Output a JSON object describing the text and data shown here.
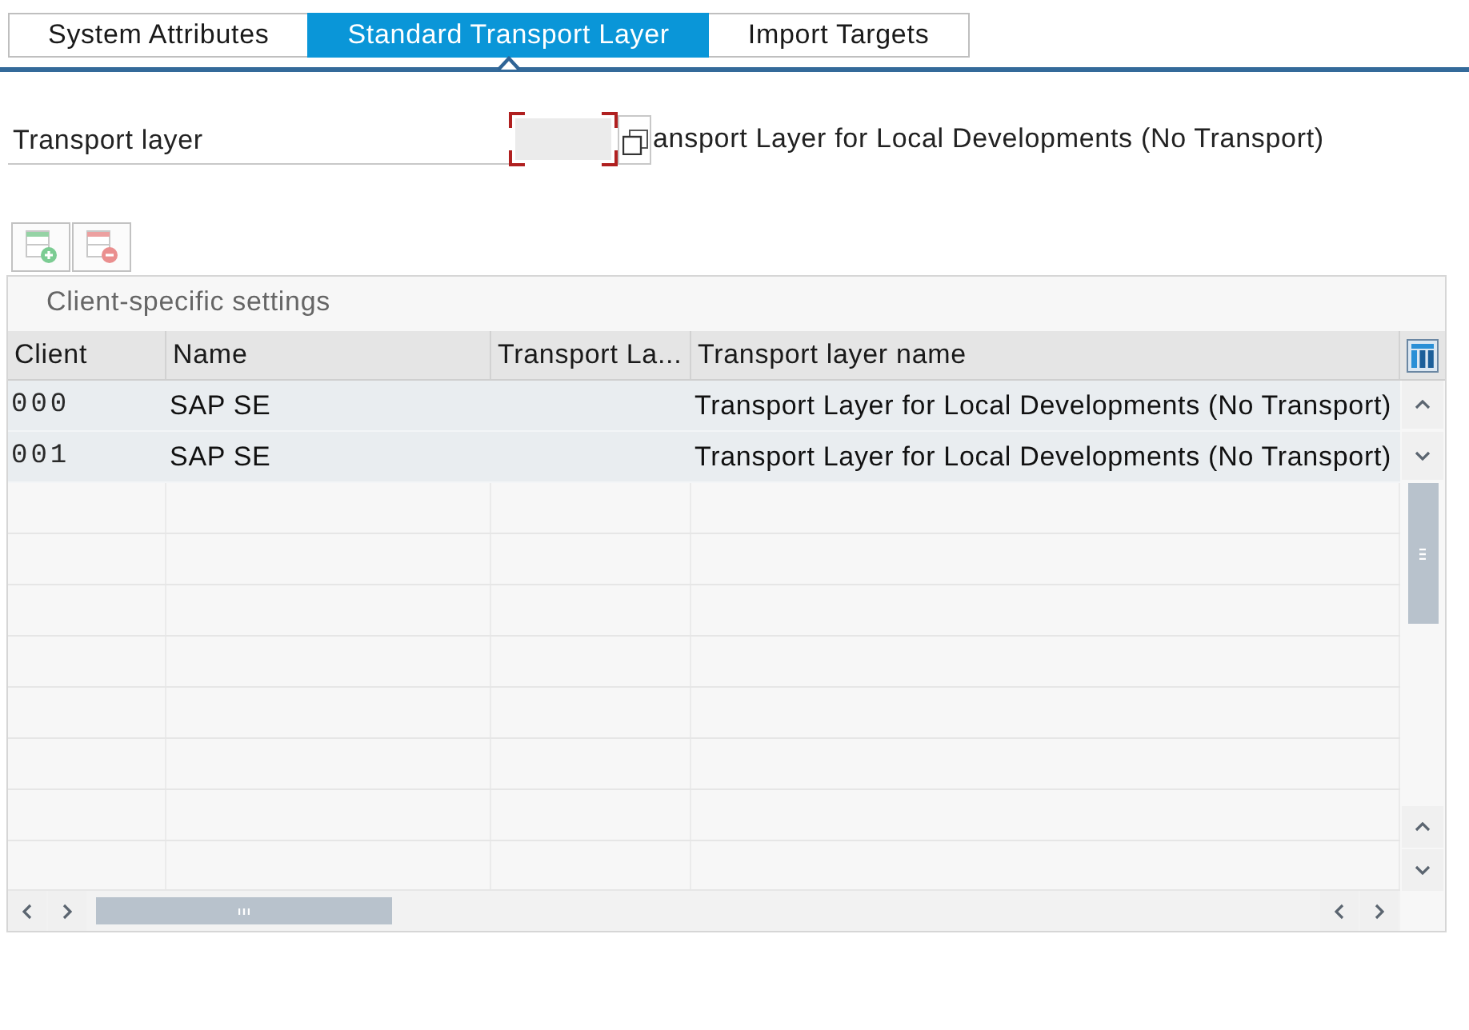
{
  "tabs": [
    {
      "label": "System Attributes",
      "selected": false
    },
    {
      "label": "Standard Transport Layer",
      "selected": true
    },
    {
      "label": "Import Targets",
      "selected": false
    }
  ],
  "transport_layer": {
    "label": "Transport layer",
    "focused": true,
    "description": "ansport Layer for Local Developments (No Transport)"
  },
  "toolbar": [
    {
      "kind": "insert"
    },
    {
      "kind": "delete"
    }
  ],
  "table": {
    "title": "Client-specific settings",
    "columns": [
      "Client",
      "Name",
      "Transport La...",
      "Transport layer name"
    ],
    "rows": [
      {
        "client": "000",
        "name": "SAP SE",
        "transport_layer_name": "Transport Layer for Local Developments (No Transport)"
      },
      {
        "client": "001",
        "name": "SAP SE",
        "transport_layer_name": "Transport Layer for Local Developments (No Transport)"
      }
    ]
  }
}
